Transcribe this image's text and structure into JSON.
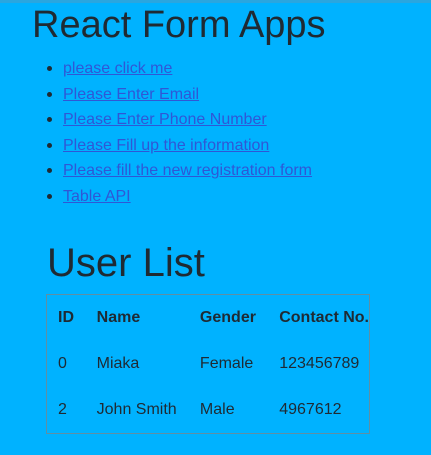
{
  "app": {
    "title": "React Form Apps"
  },
  "nav": {
    "links": [
      {
        "label": "please click me"
      },
      {
        "label": "Please Enter Email"
      },
      {
        "label": "Please Enter Phone Number"
      },
      {
        "label": "Please Fill up the information"
      },
      {
        "label": "Please fill the new registration form"
      },
      {
        "label": "Table API"
      }
    ]
  },
  "user_list": {
    "title": "User List",
    "columns": [
      "ID",
      "Name",
      "Gender",
      "Contact No."
    ],
    "rows": [
      {
        "id": "0",
        "name": "Miaka",
        "gender": "Female",
        "contact": "123456789"
      },
      {
        "id": "2",
        "name": "John Smith",
        "gender": "Male",
        "contact": "4967612"
      }
    ]
  },
  "colors": {
    "background": "#00b2ff",
    "link": "#2f57d6",
    "text": "#1f2a33",
    "table_border": "#5f8fa3"
  }
}
